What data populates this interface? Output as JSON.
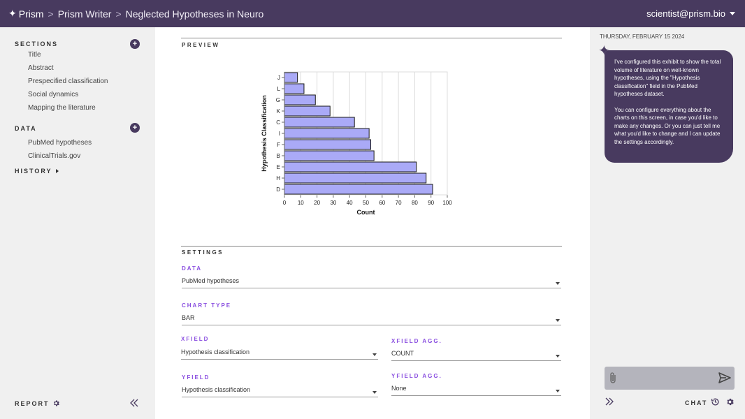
{
  "topbar": {
    "brand": "Prism",
    "crumbs": [
      "Prism Writer",
      "Neglected Hypotheses in Neuro"
    ],
    "user": "scientist@prism.bio"
  },
  "sidebar": {
    "sections_label": "SECTIONS",
    "sections": [
      "Title",
      "Abstract",
      "Prespecified classification",
      "Social dynamics",
      "Mapping the literature"
    ],
    "data_label": "DATA",
    "data_items": [
      "PubMed hypotheses",
      "ClinicalTrials.gov"
    ],
    "history_label": "HISTORY",
    "report_label": "REPORT"
  },
  "main": {
    "preview_label": "PREVIEW",
    "settings_label": "SETTINGS",
    "data_field": {
      "label": "DATA",
      "value": "PubMed hypotheses"
    },
    "chart_type_field": {
      "label": "CHART TYPE",
      "value": "BAR"
    },
    "xfield": {
      "label": "XFIELD",
      "value": "Hypothesis classification"
    },
    "xfield_agg": {
      "label": "XFIELD AGG.",
      "value": "COUNT"
    },
    "yfield": {
      "label": "YFIELD",
      "value": "Hypothesis classification"
    },
    "yfield_agg": {
      "label": "YFIELD AGG.",
      "value": "None"
    }
  },
  "chart_data": {
    "type": "bar",
    "orientation": "horizontal",
    "categories": [
      "J",
      "L",
      "G",
      "K",
      "C",
      "I",
      "F",
      "B",
      "E",
      "H",
      "D"
    ],
    "values": [
      8,
      12,
      19,
      28,
      43,
      52,
      53,
      55,
      81,
      87,
      91
    ],
    "xlabel": "Count",
    "ylabel": "Hypothesis Classification",
    "xlim": [
      0,
      100
    ],
    "xticks": [
      0,
      10,
      20,
      30,
      40,
      50,
      60,
      70,
      80,
      90,
      100
    ],
    "grid": "vertical",
    "bar_color": "#aaaaf7",
    "bar_stroke": "#1a1a1a"
  },
  "chat": {
    "date": "THURSDAY, FEBRUARY 15 2024",
    "message_p1": "I've configured this exhibit to show the total volume of literature on well-known hypotheses, using the \"Hypothesis classification\" field in the PubMed hypotheses dataset.",
    "message_p2": "You can configure everything about the charts on this screen, in case you'd like to make any changes. Or you can just tell me what you'd like to change and I can update the settings accordingly.",
    "input_placeholder": "",
    "chat_label": "CHAT"
  },
  "colors": {
    "brand": "#483a5f",
    "field_label": "#8a4fe0",
    "panel_bg": "#f0f0f0"
  }
}
